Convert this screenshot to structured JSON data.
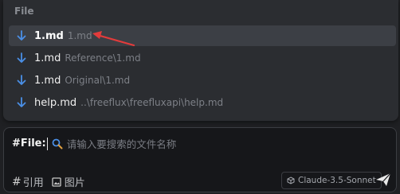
{
  "popup": {
    "header": "File",
    "items": [
      {
        "name": "1.md",
        "path": "1.md",
        "selected": true,
        "icon": "download-arrow-icon"
      },
      {
        "name": "1.md",
        "path": "Reference\\1.md",
        "selected": false,
        "icon": "download-arrow-icon"
      },
      {
        "name": "1.md",
        "path": "Original\\1.md",
        "selected": false,
        "icon": "download-arrow-icon"
      },
      {
        "name": "help.md",
        "path": "..\\freeflux\\freefluxapi\\help.md",
        "selected": false,
        "icon": "download-arrow-icon"
      }
    ]
  },
  "annotation": {
    "color": "#e23b3b",
    "icon": "red-pointer-arrow"
  },
  "input": {
    "tag": "#File:",
    "placeholder": "请输入要搜索的文件名称",
    "icon": "search-icon"
  },
  "toolbar": {
    "ref_hash": "#",
    "ref_label": "引用",
    "image_label": "图片",
    "model": "Claude-3.5-Sonnet",
    "send_icon": "send-icon"
  },
  "colors": {
    "accent": "#4a8fe6",
    "background": "#1f2023",
    "popup": "#2b2d31"
  }
}
